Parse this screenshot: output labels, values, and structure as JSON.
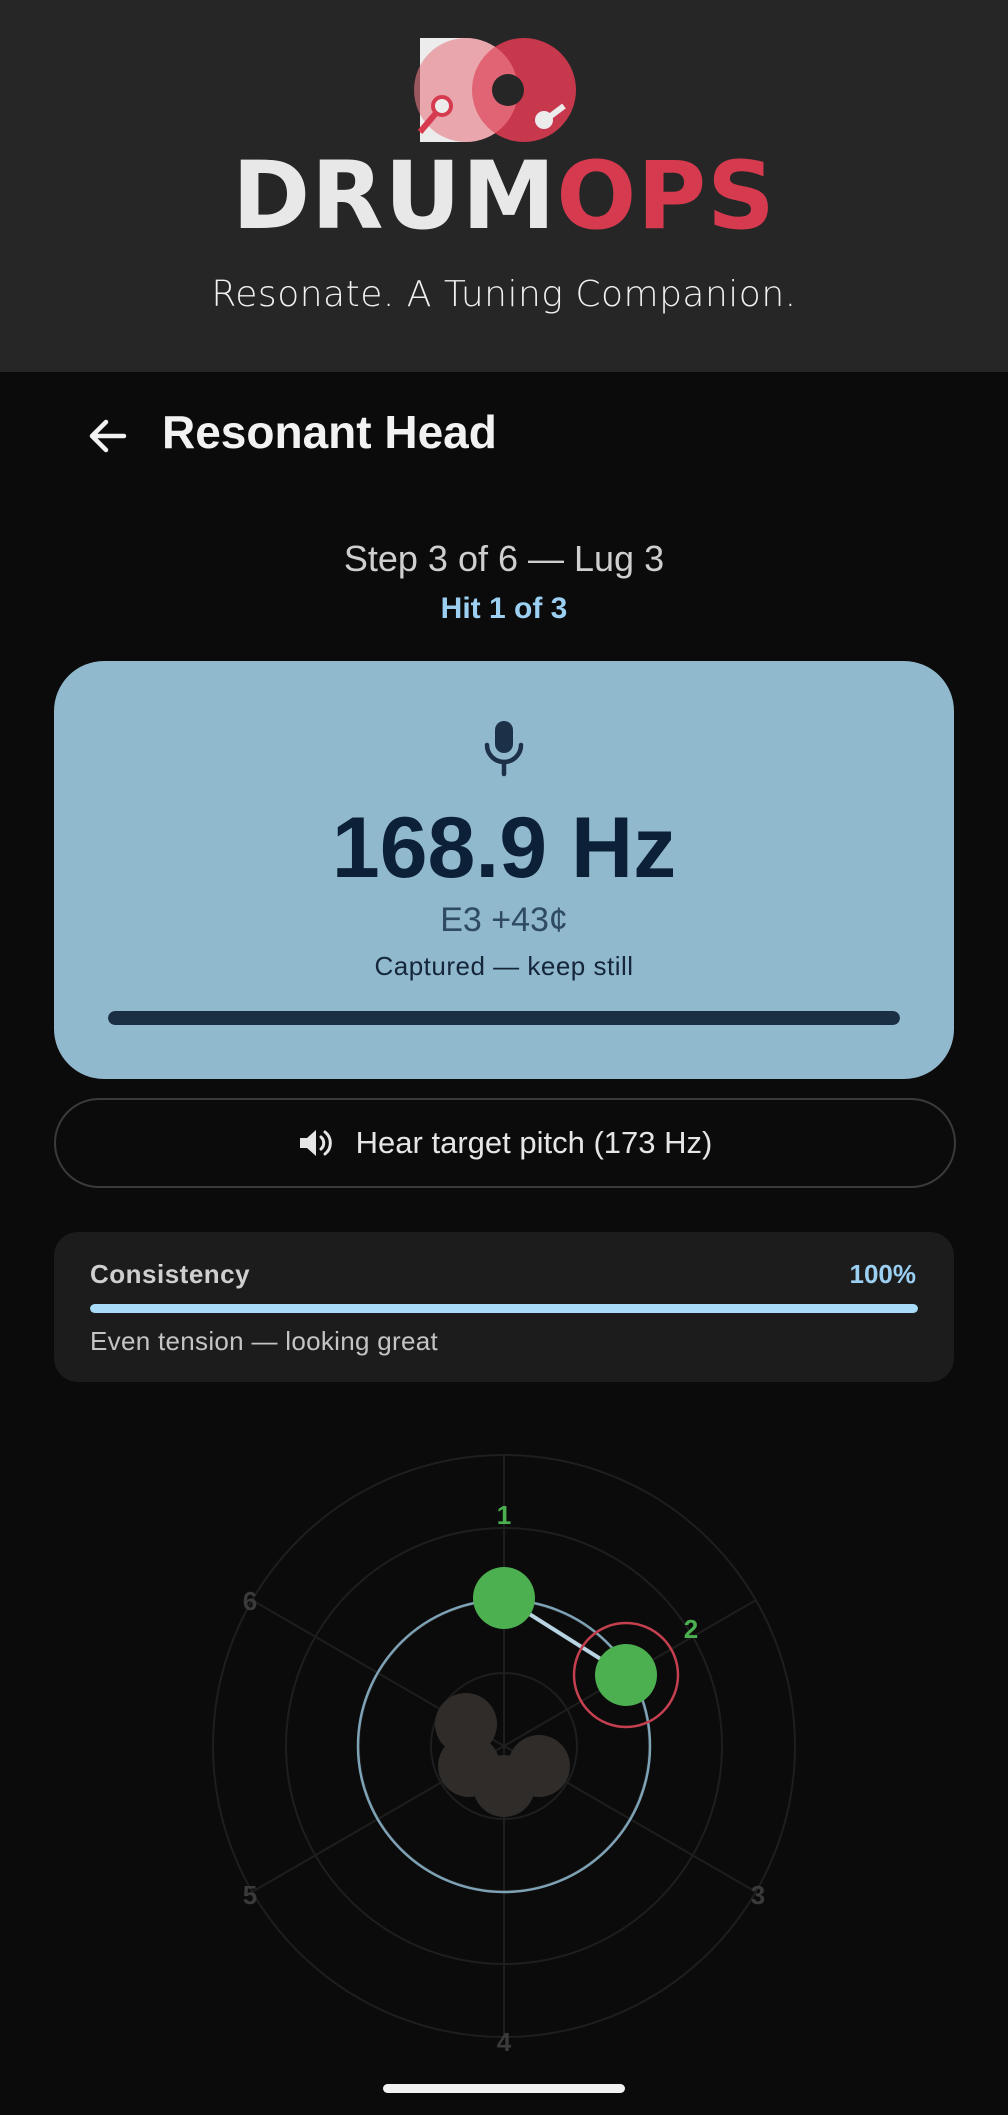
{
  "header": {
    "brand_part1": "DRUM",
    "brand_part2": "OPS",
    "tagline": "Resonate. A Tuning Companion."
  },
  "topbar": {
    "back_icon": "arrow-left-icon",
    "title": "Resonant Head"
  },
  "progress": {
    "step": "Step 3 of 6 — Lug 3",
    "hit": "Hit 1 of 3"
  },
  "reading": {
    "icon": "microphone-icon",
    "frequency": "168.9 Hz",
    "note": "E3 +43¢",
    "status": "Captured — keep still",
    "capture_progress": 1.0
  },
  "target_button": {
    "icon": "speaker-icon",
    "label": "Hear target pitch (173 Hz)"
  },
  "consistency": {
    "title": "Consistency",
    "percent_label": "100%",
    "value": 1.0,
    "message": "Even tension — looking great"
  },
  "lug_map": {
    "lug_labels": [
      "1",
      "2",
      "3",
      "4",
      "5",
      "6"
    ],
    "tuned_lugs": [
      1,
      2
    ],
    "current_lug": 2
  },
  "colors": {
    "accent": "#d63a4f",
    "card": "#90b9cd",
    "highlight": "#9bd0f2",
    "lug_done": "#4cb050"
  }
}
